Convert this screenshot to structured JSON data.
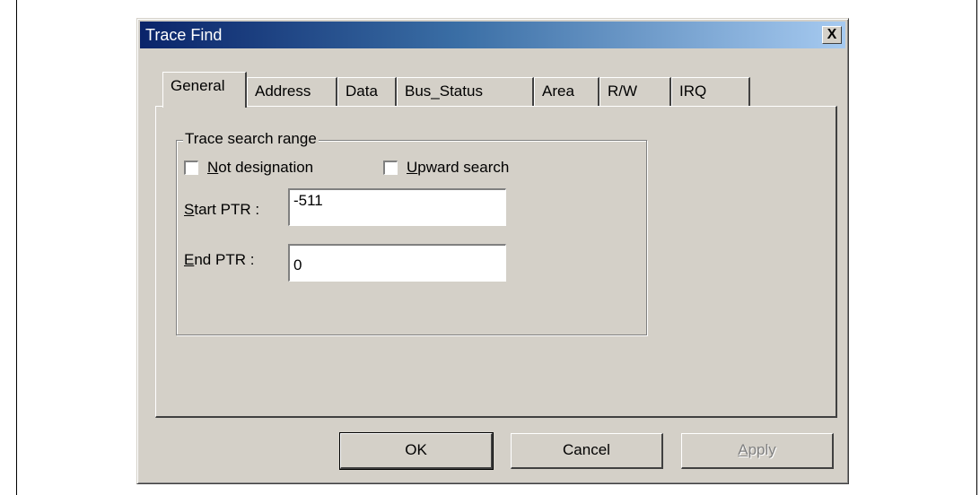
{
  "window": {
    "title": "Trace Find",
    "close_label": "X"
  },
  "tabs": [
    {
      "label": "General",
      "active": true
    },
    {
      "label": "Address"
    },
    {
      "label": "Data"
    },
    {
      "label": "Bus_Status"
    },
    {
      "label": "Area"
    },
    {
      "label": "R/W"
    },
    {
      "label": "IRQ"
    }
  ],
  "group": {
    "title": "Trace search range",
    "not_designation": {
      "prefix": "",
      "accel": "N",
      "rest": "ot designation",
      "checked": false
    },
    "upward_search": {
      "prefix": "",
      "accel": "U",
      "rest": "pward search",
      "checked": false
    },
    "start_ptr": {
      "accel": "S",
      "rest": "tart PTR :",
      "value": "-511"
    },
    "end_ptr": {
      "accel": "E",
      "rest": "nd PTR :",
      "value": "0"
    }
  },
  "buttons": {
    "ok": "OK",
    "cancel": "Cancel",
    "apply": {
      "accel": "A",
      "rest": "pply"
    }
  }
}
